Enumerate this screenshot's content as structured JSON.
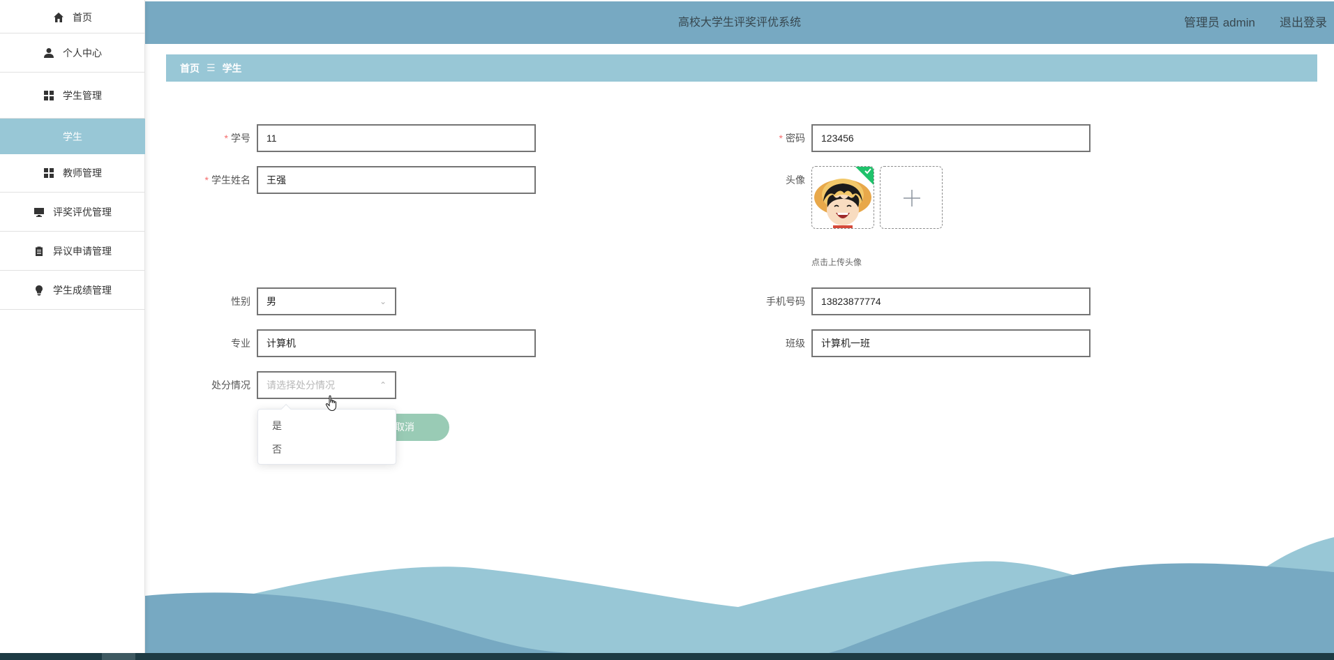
{
  "sidebar": {
    "items": [
      {
        "label": "首页",
        "icon": "home-icon"
      },
      {
        "label": "个人中心",
        "icon": "user-icon"
      },
      {
        "label": "学生管理",
        "icon": "grid-icon"
      },
      {
        "label": "学生",
        "icon": ""
      },
      {
        "label": "教师管理",
        "icon": "grid-icon"
      },
      {
        "label": "评奖评优管理",
        "icon": "monitor-icon"
      },
      {
        "label": "异议申请管理",
        "icon": "clipboard-icon"
      },
      {
        "label": "学生成绩管理",
        "icon": "bulb-icon"
      }
    ],
    "active_sub": "学生"
  },
  "header": {
    "title": "高校大学生评奖评优系统",
    "user": "管理员 admin",
    "logout": "退出登录"
  },
  "breadcrumb": {
    "home": "首页",
    "separator": "☰",
    "current": "学生"
  },
  "form": {
    "student_id": {
      "label": "学号",
      "value": "11",
      "required": true
    },
    "password": {
      "label": "密码",
      "value": "123456",
      "required": true
    },
    "name": {
      "label": "学生姓名",
      "value": "王强",
      "required": true
    },
    "avatar": {
      "label": "头像",
      "hint": "点击上传头像"
    },
    "gender": {
      "label": "性别",
      "value": "男"
    },
    "phone": {
      "label": "手机号码",
      "value": "13823877774"
    },
    "major": {
      "label": "专业",
      "value": "计算机"
    },
    "class": {
      "label": "班级",
      "value": "计算机一班"
    },
    "discipline": {
      "label": "处分情况",
      "placeholder": "请选择处分情况"
    },
    "cancel_label": "取消"
  },
  "dropdown": {
    "options": [
      "是",
      "否"
    ]
  },
  "colors": {
    "header": "#77a9c2",
    "breadcrumb": "#98c7d6",
    "active_menu": "#98c7d6",
    "cancel_button": "#99cbb5",
    "required_star": "#f56c6c",
    "wave_light": "#98c7d6",
    "wave_dark": "#77a9c2"
  }
}
